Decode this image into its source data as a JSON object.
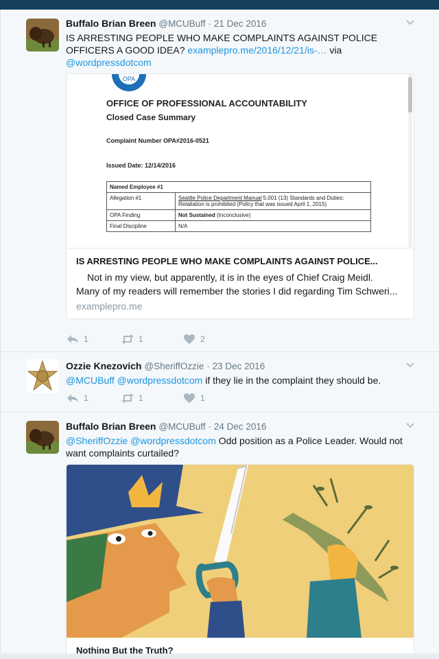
{
  "tweets": [
    {
      "fullname": "Buffalo Brian Breen",
      "screen_name": "@MCUBuff",
      "separator": "·",
      "time": "21 Dec 2016",
      "text_line1": "IS ARRESTING PEOPLE WHO MAKE COMPLAINTS AGAINST POLICE",
      "text_line2_prefix": "OFFICERS A GOOD IDEA? ",
      "text_link": "examplepro.me/2016/12/21/is-…",
      "text_via": " via",
      "text_mention": "@wordpressdotcom",
      "card": {
        "doc_title": "OFFICE OF PROFESSIONAL ACCOUNTABILITY",
        "doc_subtitle": "Closed Case Summary",
        "doc_complaint": "Complaint Number OPA#2016-0521",
        "doc_issued": "Issued Date: 12/14/2016",
        "table": {
          "named_employee": "Named Employee #1",
          "allegation_label": "Allegation #1",
          "allegation_value_link": "Seattle Police Department Manual",
          "allegation_value_rest": "  5.001 (13) Standards and Duties: Retaliation is prohibited (Policy that was issued April 1, 2015)",
          "finding_label": "OPA Finding",
          "finding_value_bold": "Not Sustained",
          "finding_value_rest": " (Inconclusive)",
          "discipline_label": "Final Discipline",
          "discipline_value": "N/A"
        },
        "title": "IS ARRESTING PEOPLE WHO MAKE COMPLAINTS AGAINST POLICE...",
        "desc_line1": "Not in my view, but apparently, it is in the eyes of Chief Craig Meidl.",
        "desc_line2": "Many of my readers will remember the stories I did regarding Tim Schweri...",
        "domain": "examplepro.me"
      },
      "replies": "1",
      "retweets": "1",
      "likes": "2"
    },
    {
      "fullname": "Ozzie Knezovich",
      "screen_name": "@SheriffOzzie",
      "separator": "·",
      "time": "23 Dec 2016",
      "mention1": "@MCUBuff",
      "mention2": "@wordpressdotcom",
      "text_rest": " if they lie in the complaint they should be.",
      "replies": "1",
      "retweets": "1",
      "likes": "1"
    },
    {
      "fullname": "Buffalo Brian Breen",
      "screen_name": "@MCUBuff",
      "separator": "·",
      "time": "24 Dec 2016",
      "mention1": "@SheriffOzzie",
      "mention2": "@wordpressdotcom",
      "text_rest": " Odd position as a Police Leader. Would not",
      "text_line2": "want complaints curtailed?",
      "card_title": "Nothing But the Truth?"
    }
  ],
  "colors": {
    "link": "#1b95e0",
    "topbar": "#14405e",
    "stream_bg": "#f5f8fa",
    "illustration_bg": "#f0cf7a"
  },
  "icons": [
    "reply-icon",
    "retweet-icon",
    "like-icon",
    "caret-down-icon",
    "avatar-bison",
    "avatar-sheriff-star"
  ]
}
